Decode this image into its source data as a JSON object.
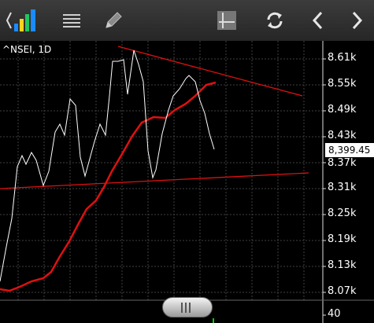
{
  "toolbar": {
    "icons": [
      "chart-type-icon",
      "menu-icon",
      "pencil-icon",
      "crosshair-icon",
      "refresh-icon",
      "back-arrow-icon",
      "forward-arrow-icon"
    ]
  },
  "chart": {
    "symbol": "^NSEI, 1D",
    "last_price": "8,399.45",
    "y_ticks": [
      "8.61k",
      "8.55k",
      "8.49k",
      "8.43k",
      "8.37k",
      "8.31k",
      "8.25k",
      "8.19k",
      "8.13k",
      "8.07k"
    ],
    "volume_tick": "40",
    "colors": {
      "price": "#ffffff",
      "ma": "#e01010",
      "trendline": "#e01010",
      "grid": "#444444",
      "volume": "#00d000"
    }
  }
}
